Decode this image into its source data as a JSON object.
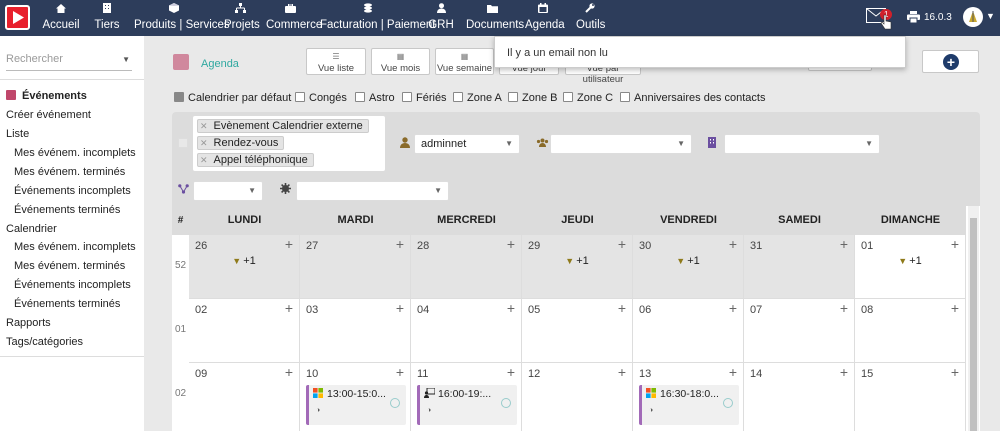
{
  "nav": {
    "items": [
      {
        "label": "Accueil",
        "icon": "home-icon"
      },
      {
        "label": "Tiers",
        "icon": "building-icon"
      },
      {
        "label": "Produits | Services",
        "icon": "cube-icon"
      },
      {
        "label": "Projets",
        "icon": "sitemap-icon"
      },
      {
        "label": "Commerce",
        "icon": "briefcase-icon"
      },
      {
        "label": "Facturation | Paiement",
        "icon": "coins-icon"
      },
      {
        "label": "GRH",
        "icon": "user-icon"
      },
      {
        "label": "Documents",
        "icon": "folder-icon"
      },
      {
        "label": "Agenda",
        "icon": "calendar-icon"
      },
      {
        "label": "Outils",
        "icon": "wrench-icon"
      }
    ],
    "mail_badge": "1",
    "version": "16.0.3"
  },
  "tooltip": "Il y a un email non lu",
  "left": {
    "search_placeholder": "Rechercher",
    "menu": [
      {
        "label": "Événements",
        "level": "head"
      },
      {
        "label": "Créer événement",
        "level": "top"
      },
      {
        "label": "Liste",
        "level": "top"
      },
      {
        "label": "Mes événem. incomplets",
        "level": "sub"
      },
      {
        "label": "Mes événem. terminés",
        "level": "sub"
      },
      {
        "label": "Événements incomplets",
        "level": "sub"
      },
      {
        "label": "Événements terminés",
        "level": "sub"
      },
      {
        "label": "Calendrier",
        "level": "top"
      },
      {
        "label": "Mes événem. incomplets",
        "level": "sub"
      },
      {
        "label": "Mes événem. terminés",
        "level": "sub"
      },
      {
        "label": "Événements incomplets",
        "level": "sub"
      },
      {
        "label": "Événements terminés",
        "level": "sub"
      },
      {
        "label": "Rapports",
        "level": "top"
      },
      {
        "label": "Tags/catégories",
        "level": "top"
      }
    ]
  },
  "main": {
    "title": "Agenda",
    "views": [
      "Vue liste",
      "Vue mois",
      "Vue semaine",
      "Vue jour",
      "Vue par utilisateur"
    ],
    "filters": [
      {
        "label": "Calendrier par défaut",
        "checked": true
      },
      {
        "label": "Congés",
        "checked": false
      },
      {
        "label": "Astro",
        "checked": false
      },
      {
        "label": "Fériés",
        "checked": false
      },
      {
        "label": "Zone A",
        "checked": false
      },
      {
        "label": "Zone B",
        "checked": false
      },
      {
        "label": "Zone C",
        "checked": false
      },
      {
        "label": "Anniversaires des contacts",
        "checked": false
      }
    ],
    "tags": [
      "Evènement Calendrier externe",
      "Rendez-vous",
      "Appel téléphonique"
    ],
    "user_select": "adminnet"
  },
  "calendar": {
    "days": [
      "LUNDI",
      "MARDI",
      "MERCREDI",
      "JEUDI",
      "VENDREDI",
      "SAMEDI",
      "DIMANCHE"
    ],
    "weeks": [
      {
        "num": "52",
        "dates": [
          "26",
          "27",
          "28",
          "29",
          "30",
          "31",
          "01"
        ]
      },
      {
        "num": "01",
        "dates": [
          "02",
          "03",
          "04",
          "05",
          "06",
          "07",
          "08"
        ]
      },
      {
        "num": "02",
        "dates": [
          "09",
          "10",
          "11",
          "12",
          "13",
          "14",
          "15"
        ]
      }
    ],
    "more_label": "+1",
    "events": [
      "13:00-15:0...",
      "16:00-19:...",
      "16:30-18:0..."
    ]
  }
}
